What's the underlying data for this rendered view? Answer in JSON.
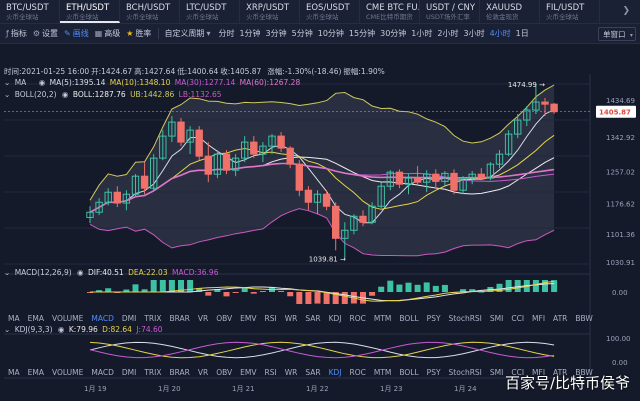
{
  "ticker": [
    {
      "symbol": "BTC/USDT",
      "sub": "火币全球站",
      "active": false
    },
    {
      "symbol": "ETH/USDT",
      "sub": "火币全球站",
      "active": true
    },
    {
      "symbol": "BCH/USDT",
      "sub": "火币全球站",
      "active": false
    },
    {
      "symbol": "LTC/USDT",
      "sub": "火币全球站",
      "active": false
    },
    {
      "symbol": "XRP/USDT",
      "sub": "火币全球站",
      "active": false
    },
    {
      "symbol": "EOS/USDT",
      "sub": "火币全球站",
      "active": false
    },
    {
      "symbol": "CME BTC FU...",
      "sub": "CME比特币期货",
      "active": false
    },
    {
      "symbol": "USDT / CNY",
      "sub": "USDT场外汇率",
      "active": false
    },
    {
      "symbol": "XAUUSD",
      "sub": "伦敦金现货",
      "active": false
    },
    {
      "symbol": "FIL/USDT",
      "sub": "火币全球站",
      "active": false
    }
  ],
  "toolbar": {
    "tools": [
      {
        "label": "指标",
        "icon": "fx-icon",
        "glyph": "ƒ",
        "selected": false,
        "gold": false
      },
      {
        "label": "设置",
        "icon": "gear-icon",
        "glyph": "⚙",
        "selected": false,
        "gold": false
      },
      {
        "label": "画线",
        "icon": "pencil-icon",
        "glyph": "✎",
        "selected": true,
        "gold": false
      },
      {
        "label": "高级",
        "icon": "grid-icon",
        "glyph": "▦",
        "selected": false,
        "gold": false
      },
      {
        "label": "胜率",
        "icon": "star-icon",
        "glyph": "★",
        "selected": false,
        "gold": true
      }
    ],
    "custom_period": "自定义周期",
    "custom_icon": "chevron-down-icon",
    "timeframes": [
      "分时",
      "1分钟",
      "3分钟",
      "5分钟",
      "10分钟",
      "15分钟",
      "30分钟",
      "1小时",
      "2小时",
      "3小时",
      "4小时",
      "1日"
    ],
    "selected_timeframe": "4小时",
    "layout_label": "单窗口"
  },
  "legend": {
    "time": "时间:2021-01-25 16:00",
    "open": "开:1424.67",
    "high": "高:1427.64",
    "low": "低:1400.64",
    "close": "收:1405.87",
    "change": "涨幅:-1.30%(-18.46)",
    "amplitude": "振幅:1.90%",
    "ma_name": "MA",
    "ma5": "MA(5):1395.14",
    "ma10": "MA(10):1348.10",
    "ma30": "MA(30):1277.14",
    "ma60": "MA(60):1267.28",
    "boll_name": "BOLL(20,2)",
    "boll": "BOLL:1287.76",
    "ub": "UB:1442.86",
    "lb": "LB:1132.65",
    "macd_name": "MACD(12,26,9)",
    "dif": "DIF:40.51",
    "dea": "DEA:22.03",
    "macd": "MACD:36.96",
    "kdj_name": "KDJ(9,3,3)",
    "k": "K:79.96",
    "d": "D:82.64",
    "j": "J:74.60"
  },
  "colors": {
    "up": "#3ec0a3",
    "down": "#f0706a",
    "ma5": "#d8dde8",
    "ma10": "#e5d34a",
    "ma30": "#c85ad6",
    "ma60": "#dc77c8",
    "boll": "#eeeeee",
    "ub": "#cfcb5c",
    "lb": "#c95ac0",
    "accent": "#4f8cff"
  },
  "axis": {
    "price_ticks": [
      "1434.69",
      "1342.92",
      "1257.02",
      "1176.62",
      "1101.36",
      "1030.91"
    ],
    "current_price": "1405.87",
    "high_label": "1474.99",
    "low_label": "1039.81",
    "macd_ticks": [
      "0.00"
    ],
    "kdj_ticks": [
      "100.00",
      "0.00"
    ],
    "dates": [
      "1月 19",
      "1月 20",
      "1月 21",
      "1月 22",
      "1月 23",
      "1月 24"
    ]
  },
  "indicator_tabs": [
    "MA",
    "EMA",
    "VOLUME",
    "MACD",
    "DMI",
    "TRIX",
    "BRAR",
    "VR",
    "OBV",
    "EMV",
    "RSI",
    "WR",
    "SAR",
    "KDJ",
    "ROC",
    "MTM",
    "BOLL",
    "PSY",
    "StochRSI",
    "SMI",
    "CCI",
    "MFI",
    "ATR",
    "BBW"
  ],
  "indicator_selected_top": "MACD",
  "indicator_selected_bottom": "KDJ",
  "watermark": "百家号/比特币侯爷",
  "chart_data": {
    "type": "candlestick",
    "interval": "4小时",
    "candles": [
      {
        "o": 1142,
        "h": 1170,
        "l": 1128,
        "c": 1155
      },
      {
        "o": 1155,
        "h": 1190,
        "l": 1148,
        "c": 1180
      },
      {
        "o": 1180,
        "h": 1215,
        "l": 1172,
        "c": 1205
      },
      {
        "o": 1205,
        "h": 1220,
        "l": 1168,
        "c": 1178
      },
      {
        "o": 1178,
        "h": 1210,
        "l": 1160,
        "c": 1200
      },
      {
        "o": 1200,
        "h": 1250,
        "l": 1195,
        "c": 1245
      },
      {
        "o": 1245,
        "h": 1280,
        "l": 1200,
        "c": 1215
      },
      {
        "o": 1215,
        "h": 1300,
        "l": 1210,
        "c": 1290
      },
      {
        "o": 1290,
        "h": 1360,
        "l": 1285,
        "c": 1345
      },
      {
        "o": 1345,
        "h": 1395,
        "l": 1330,
        "c": 1380
      },
      {
        "o": 1380,
        "h": 1390,
        "l": 1320,
        "c": 1330
      },
      {
        "o": 1330,
        "h": 1370,
        "l": 1300,
        "c": 1360
      },
      {
        "o": 1360,
        "h": 1370,
        "l": 1285,
        "c": 1295
      },
      {
        "o": 1295,
        "h": 1330,
        "l": 1230,
        "c": 1250
      },
      {
        "o": 1250,
        "h": 1310,
        "l": 1240,
        "c": 1300
      },
      {
        "o": 1300,
        "h": 1310,
        "l": 1250,
        "c": 1260
      },
      {
        "o": 1260,
        "h": 1300,
        "l": 1245,
        "c": 1290
      },
      {
        "o": 1290,
        "h": 1345,
        "l": 1280,
        "c": 1330
      },
      {
        "o": 1330,
        "h": 1345,
        "l": 1290,
        "c": 1300
      },
      {
        "o": 1300,
        "h": 1330,
        "l": 1280,
        "c": 1320
      },
      {
        "o": 1320,
        "h": 1350,
        "l": 1300,
        "c": 1345
      },
      {
        "o": 1345,
        "h": 1355,
        "l": 1305,
        "c": 1315
      },
      {
        "o": 1315,
        "h": 1320,
        "l": 1265,
        "c": 1275
      },
      {
        "o": 1275,
        "h": 1285,
        "l": 1195,
        "c": 1210
      },
      {
        "o": 1210,
        "h": 1220,
        "l": 1160,
        "c": 1180
      },
      {
        "o": 1180,
        "h": 1210,
        "l": 1150,
        "c": 1200
      },
      {
        "o": 1200,
        "h": 1210,
        "l": 1160,
        "c": 1170
      },
      {
        "o": 1170,
        "h": 1180,
        "l": 1060,
        "c": 1090
      },
      {
        "o": 1090,
        "h": 1130,
        "l": 1039.81,
        "c": 1110
      },
      {
        "o": 1110,
        "h": 1150,
        "l": 1100,
        "c": 1145
      },
      {
        "o": 1145,
        "h": 1160,
        "l": 1120,
        "c": 1130
      },
      {
        "o": 1130,
        "h": 1180,
        "l": 1125,
        "c": 1170
      },
      {
        "o": 1170,
        "h": 1230,
        "l": 1165,
        "c": 1220
      },
      {
        "o": 1220,
        "h": 1260,
        "l": 1210,
        "c": 1255
      },
      {
        "o": 1255,
        "h": 1262,
        "l": 1215,
        "c": 1225
      },
      {
        "o": 1225,
        "h": 1250,
        "l": 1200,
        "c": 1240
      },
      {
        "o": 1240,
        "h": 1270,
        "l": 1225,
        "c": 1230
      },
      {
        "o": 1230,
        "h": 1260,
        "l": 1205,
        "c": 1250
      },
      {
        "o": 1250,
        "h": 1262,
        "l": 1218,
        "c": 1232
      },
      {
        "o": 1232,
        "h": 1258,
        "l": 1222,
        "c": 1252
      },
      {
        "o": 1252,
        "h": 1262,
        "l": 1200,
        "c": 1210
      },
      {
        "o": 1210,
        "h": 1245,
        "l": 1200,
        "c": 1240
      },
      {
        "o": 1240,
        "h": 1258,
        "l": 1225,
        "c": 1250
      },
      {
        "o": 1250,
        "h": 1265,
        "l": 1235,
        "c": 1240
      },
      {
        "o": 1240,
        "h": 1280,
        "l": 1235,
        "c": 1275
      },
      {
        "o": 1275,
        "h": 1310,
        "l": 1265,
        "c": 1300
      },
      {
        "o": 1300,
        "h": 1360,
        "l": 1295,
        "c": 1350
      },
      {
        "o": 1350,
        "h": 1400,
        "l": 1340,
        "c": 1385
      },
      {
        "o": 1385,
        "h": 1420,
        "l": 1370,
        "c": 1410
      },
      {
        "o": 1410,
        "h": 1474.99,
        "l": 1400,
        "c": 1430
      },
      {
        "o": 1430,
        "h": 1440,
        "l": 1395,
        "c": 1424.67
      },
      {
        "o": 1424.67,
        "h": 1427.64,
        "l": 1400.64,
        "c": 1405.87
      }
    ],
    "ylim": [
      1030.91,
      1474.99
    ]
  }
}
